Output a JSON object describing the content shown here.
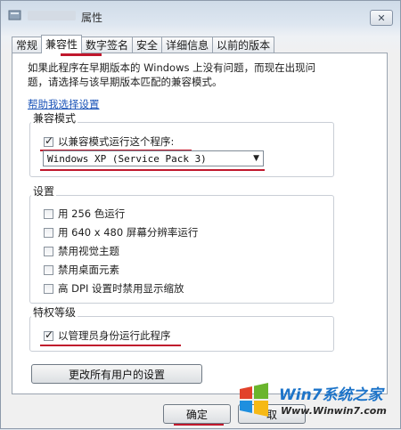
{
  "window": {
    "title": "属性",
    "close_glyph": "✕"
  },
  "tabs": [
    {
      "label": "常规",
      "active": false
    },
    {
      "label": "兼容性",
      "active": true
    },
    {
      "label": "数字签名",
      "active": false
    },
    {
      "label": "安全",
      "active": false
    },
    {
      "label": "详细信息",
      "active": false
    },
    {
      "label": "以前的版本",
      "active": false
    }
  ],
  "intro": {
    "line1": "如果此程序在早期版本的 Windows 上没有问题，而现在出现问",
    "line2": "题，请选择与该早期版本匹配的兼容模式。"
  },
  "help_link": "帮助我选择设置",
  "compat_mode": {
    "group_title": "兼容模式",
    "checkbox_label": "以兼容模式运行这个程序:",
    "checked": true,
    "selected_os": "Windows XP (Service Pack 3)"
  },
  "settings": {
    "group_title": "设置",
    "options": [
      {
        "label": "用 256 色运行",
        "checked": false
      },
      {
        "label": "用 640 x 480 屏幕分辨率运行",
        "checked": false
      },
      {
        "label": "禁用视觉主题",
        "checked": false
      },
      {
        "label": "禁用桌面元素",
        "checked": false
      },
      {
        "label": "高 DPI 设置时禁用显示缩放",
        "checked": false
      }
    ]
  },
  "privilege": {
    "group_title": "特权等级",
    "checkbox_label": "以管理员身份运行此程序",
    "checked": true
  },
  "change_all_users_button": "更改所有用户的设置",
  "footer": {
    "ok_button": "确定",
    "cancel_partial": "取"
  },
  "watermark": {
    "brand": "Win7系统之家",
    "url": "Www.Winwin7.com"
  },
  "colors": {
    "highlight_red": "#c0182d",
    "link_blue": "#1b54b8"
  }
}
